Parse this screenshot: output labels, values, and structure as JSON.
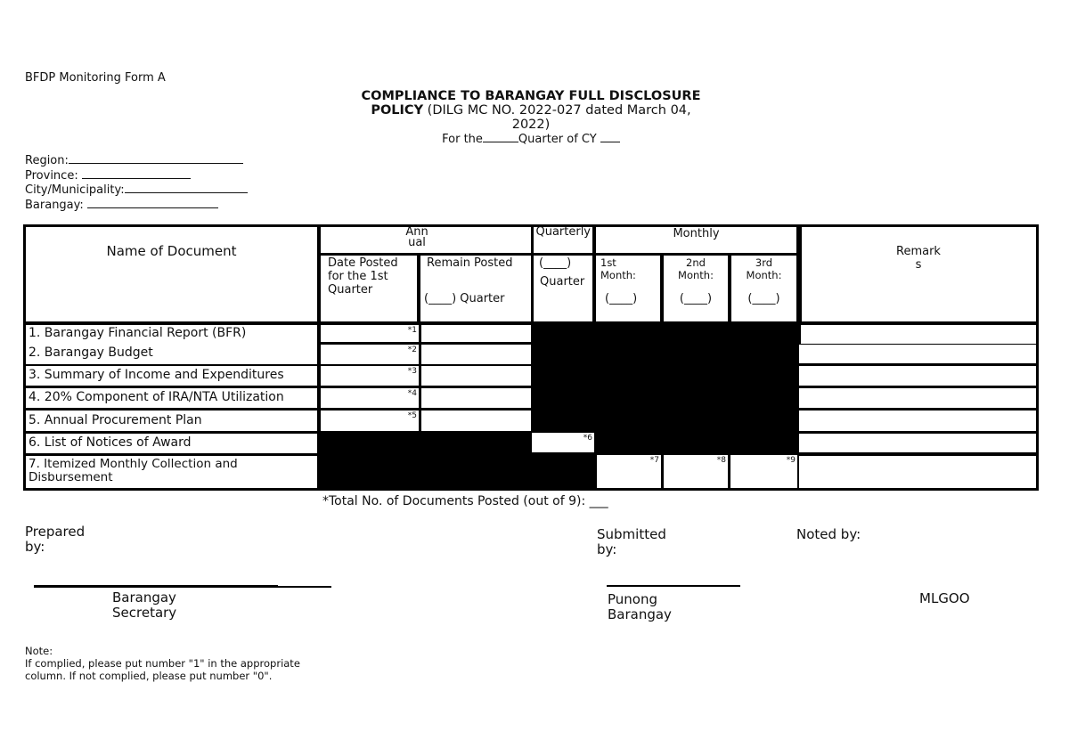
{
  "header": {
    "form_code": "BFDP Monitoring Form A",
    "title_line1": "COMPLIANCE TO BARANGAY FULL DISCLOSURE",
    "title_bold2": "POLICY",
    "title_rest2": " (DILG MC NO. 2022-027 dated March 04,",
    "title_line3": "2022)",
    "period_prefix": "For the",
    "period_mid": "Quarter of CY",
    "period_blank_1": "",
    "period_blank_2": ""
  },
  "location_fields": [
    {
      "label": "Region:",
      "value": ""
    },
    {
      "label": "Province: ",
      "value": ""
    },
    {
      "label": "City/Municipality:",
      "value": ""
    },
    {
      "label": "Barangay: ",
      "value": ""
    }
  ],
  "table": {
    "col_name": "Name of Document",
    "group_annual": "Annual",
    "group_quarterly": "Quarterly",
    "group_monthly": "Monthly",
    "col_remarks": "Remarks",
    "sub_date_posted": "Date Posted for the 1st Quarter",
    "sub_remain_line1": "Remain Posted",
    "sub_remain_line2": "(____) Quarter",
    "sub_quarter_line1": "(____)",
    "sub_quarter_line2": "Quarter",
    "sub_month1_line1": "1st",
    "sub_month1_line2": "Month:",
    "sub_month2_line1": "2nd",
    "sub_month2_line2": "Month:",
    "sub_month3_line1": "3rd",
    "sub_month3_line2": "Month:",
    "blank_paren": "(____)",
    "rows": [
      {
        "name": "1. Barangay Financial Report (BFR)",
        "mark": "*1",
        "remarks": ""
      },
      {
        "name": "2. Barangay Budget",
        "mark": "*2",
        "remarks": ""
      },
      {
        "name": "3. Summary of Income and Expenditures",
        "mark": "*3",
        "remarks": ""
      },
      {
        "name": "4. 20% Component of IRA/NTA Utilization",
        "mark": "*4",
        "remarks": ""
      },
      {
        "name": "5. Annual Procurement Plan",
        "mark": "*5",
        "remarks": ""
      },
      {
        "name": "6. List of Notices of Award",
        "mark": "*6",
        "remarks": ""
      },
      {
        "name": "7. Itemized Monthly Collection and Disbursement",
        "marks": [
          "*7",
          "*8",
          "*9"
        ],
        "remarks": ""
      }
    ]
  },
  "total_label": "*Total No. of Documents Posted (out of 9): ___",
  "signatures": {
    "prepared_by": "Prepared by:",
    "prepared_role": "Barangay Secretary",
    "submitted_by": "Submitted by:",
    "submitted_role": "Punong Barangay",
    "noted_by": "Noted by:",
    "noted_role": "MLGOO"
  },
  "note": {
    "title": "Note:",
    "text": "If complied, please put number \"1\" in the appropriate column. If not complied, please put number \"0\"."
  }
}
